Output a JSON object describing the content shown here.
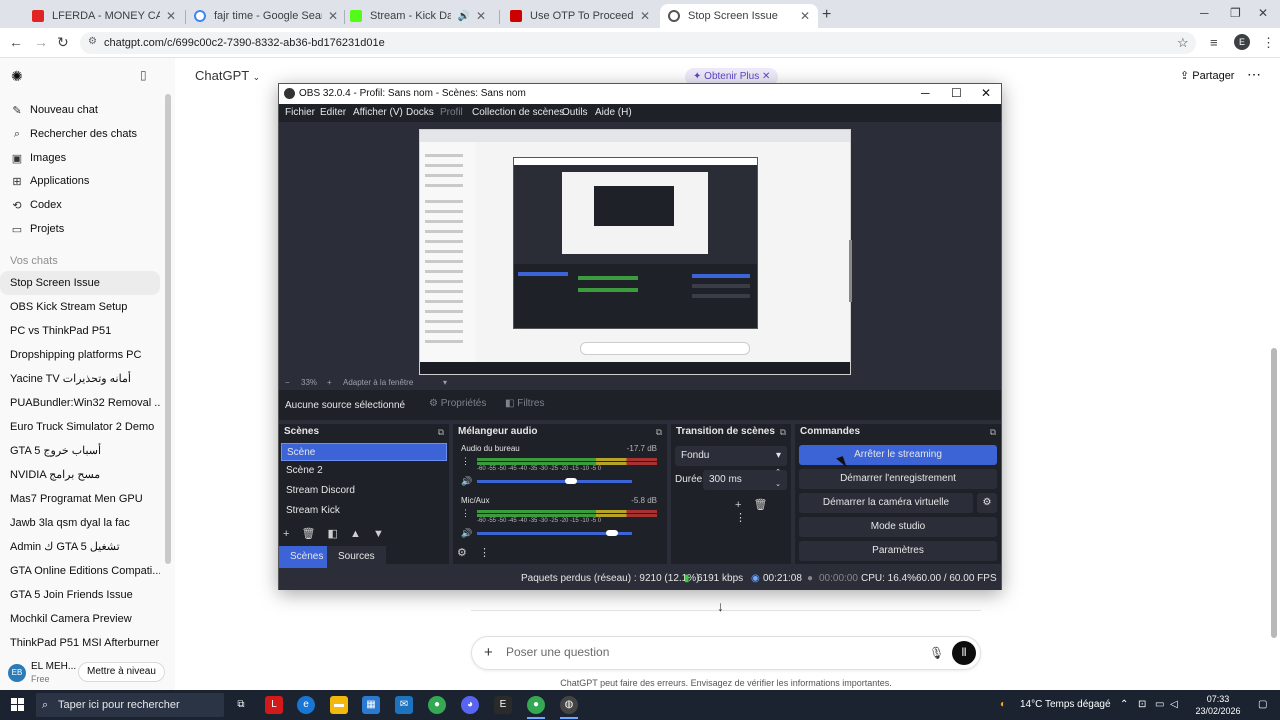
{
  "browser": {
    "tabs": [
      {
        "title": "LFERDA - MONEY CASH (AUDIO",
        "color": "#e02424"
      },
      {
        "title": "fajr time - Google Search",
        "color": "#4285f4"
      },
      {
        "title": "Stream - Kick Dashboard",
        "color": "#53fc18"
      },
      {
        "title": "Use OTP To Proceed - thinkpad",
        "color": "#cc0000"
      },
      {
        "title": "Stop Screen Issue",
        "color": "#555555"
      }
    ],
    "url": "chatgpt.com/c/699c00c2-7390-8332-ab36-bd176231d01e"
  },
  "chatgpt": {
    "model_label": "ChatGPT",
    "get_plus": "Obtenir Plus",
    "share": "Partager",
    "nav": [
      {
        "label": "Nouveau chat",
        "icon": "✎"
      },
      {
        "label": "Rechercher des chats",
        "icon": "⌕"
      },
      {
        "label": "Images",
        "icon": "▣"
      },
      {
        "label": "Applications",
        "icon": "⊞"
      },
      {
        "label": "Codex",
        "icon": "⟲"
      },
      {
        "label": "Projets",
        "icon": "▭"
      }
    ],
    "chats_header": "Vos chats",
    "chats": [
      "Stop Screen Issue",
      "OBS Kick Stream Setup",
      "PC vs ThinkPad P51",
      "Dropshipping platforms PC",
      "Yacine TV أمانه وتحذيرات",
      "PUABundler:Win32 Removal ...",
      "Euro Truck Simulator 2 Demo",
      "GTA 5 أسباب خروج",
      "NVIDIA مسح برامج",
      "Mas7 Programat Men GPU",
      "Jawb 3la qsm dyal la fac",
      "Admin ك GTA 5 تشغيل",
      "GTA Online Editions Compati...",
      "GTA 5 Join Friends Issue",
      "Mochkil Camera Preview",
      "ThinkPad P51 MSI Afterburner"
    ],
    "user": {
      "initials": "EB",
      "name": "EL MEH...",
      "plan": "Free",
      "upgrade": "Mettre à niveau"
    },
    "composer_placeholder": "Poser une question",
    "disclaimer": "ChatGPT peut faire des erreurs. Envisagez de vérifier les informations importantes."
  },
  "obs": {
    "title": "OBS 32.0.4 - Profil: Sans nom - Scènes: Sans nom",
    "menu": [
      "Fichier",
      "Editer",
      "Afficher (V)",
      "Docks",
      "Profil",
      "Collection de scènes",
      "Outils",
      "Aide (H)"
    ],
    "zoom": "33%",
    "fit": "Adapter à la fenêtre",
    "no_source": "Aucune source sélectionné",
    "properties": "Propriétés",
    "filters": "Filtres",
    "scenes_title": "Scènes",
    "scenes": [
      "Scène",
      "Scène 2",
      "Stream Discord",
      "Stream Kick"
    ],
    "scenes_tab": "Scènes",
    "sources_tab": "Sources",
    "mixer_title": "Mélangeur audio",
    "channels": [
      {
        "name": "Audio du bureau",
        "db": "-17.7 dB",
        "level": 0.72
      },
      {
        "name": "Mic/Aux",
        "db": "-5.8 dB",
        "level": 0.86
      }
    ],
    "scale": "-60 -55 -50 -45 -40 -35 -30 -25 -20 -15 -10 -5 0",
    "transition_title": "Transition de scènes",
    "transition": "Fondu",
    "duration_label": "Durée",
    "duration": "300 ms",
    "commands_title": "Commandes",
    "commands": [
      "Arrêter le streaming",
      "Démarrer l'enregistrement",
      "Démarrer la caméra virtuelle",
      "Mode studio",
      "Paramètres"
    ],
    "status": {
      "dropped": "Paquets perdus (réseau) : 9210 (12.1%)",
      "bitrate": "6191 kbps",
      "stream_time": "00:21:08",
      "rec_time": "00:00:00",
      "cpu": "CPU: 16.4%",
      "fps": "60.00 / 60.00 FPS"
    }
  },
  "taskbar": {
    "search": "Taper ici pour rechercher",
    "weather": "14°C  Temps dégagé",
    "time": "07:33",
    "date": "23/02/2026"
  }
}
